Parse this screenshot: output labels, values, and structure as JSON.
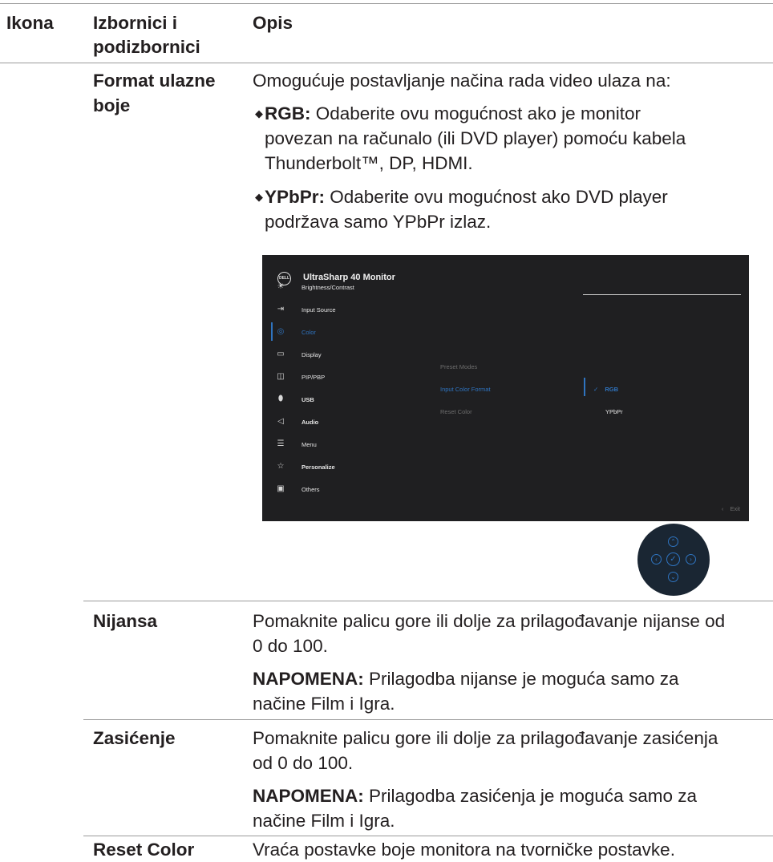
{
  "header": {
    "col_icon": "Ikona",
    "col_menus_line1": "Izbornici i",
    "col_menus_line2": "podizbornici",
    "col_desc": "Opis"
  },
  "rows": {
    "format": {
      "name_line1": "Format ulazne",
      "name_line2": "boje",
      "intro": "Omogućuje postavljanje načina rada video ulaza na:",
      "rgb_term": "RGB:",
      "rgb_line1": " Odaberite ovu mogućnost ako je monitor",
      "rgb_line2": "povezan na računalo (ili DVD player) pomoću kabela",
      "rgb_line3": "Thunderbolt™, DP, HDMI.",
      "ypbpr_term": "YPbPr:",
      "ypbpr_line1": " Odaberite ovu mogućnost ako DVD player",
      "ypbpr_line2": "podržava samo YPbPr izlaz."
    },
    "hue": {
      "name": "Nijansa",
      "desc_line1": "Pomaknite palicu gore ili dolje za prilagođavanje nijanse od",
      "desc_line2": "0 do 100.",
      "note_label": "NAPOMENA:",
      "note_line1": " Prilagodba nijanse je moguća samo za",
      "note_line2": "načine Film i Igra."
    },
    "saturation": {
      "name": "Zasićenje",
      "desc_line1": "Pomaknite palicu gore ili dolje za prilagođavanje zasićenja",
      "desc_line2": "od 0 do 100.",
      "note_label": "NAPOMENA:",
      "note_line1": " Prilagodba zasićenja je moguća samo za",
      "note_line2": "načine Film i Igra."
    },
    "reset": {
      "name": "Reset Color",
      "desc": "Vraća postavke boje monitora na tvorničke postavke."
    }
  },
  "osd": {
    "logo_text": "DELL",
    "title": "UltraSharp 40 Monitor",
    "menu": [
      {
        "label": "Brightness/Contrast",
        "icon": "brightness-icon"
      },
      {
        "label": "Input Source",
        "icon": "input-source-icon"
      },
      {
        "label": "Color",
        "icon": "color-palette-icon"
      },
      {
        "label": "Display",
        "icon": "display-icon"
      },
      {
        "label": "PIP/PBP",
        "icon": "pip-pbp-icon"
      },
      {
        "label": "USB",
        "icon": "usb-icon"
      },
      {
        "label": "Audio",
        "icon": "audio-icon"
      },
      {
        "label": "Menu",
        "icon": "menu-icon"
      },
      {
        "label": "Personalize",
        "icon": "star-icon"
      },
      {
        "label": "Others",
        "icon": "others-icon"
      }
    ],
    "submenu": [
      "Preset Modes",
      "Input Color Format",
      "Reset Color"
    ],
    "options": [
      "RGB",
      "YPbPr"
    ],
    "exit_label": "Exit",
    "accent_color": "#2f74c0"
  }
}
